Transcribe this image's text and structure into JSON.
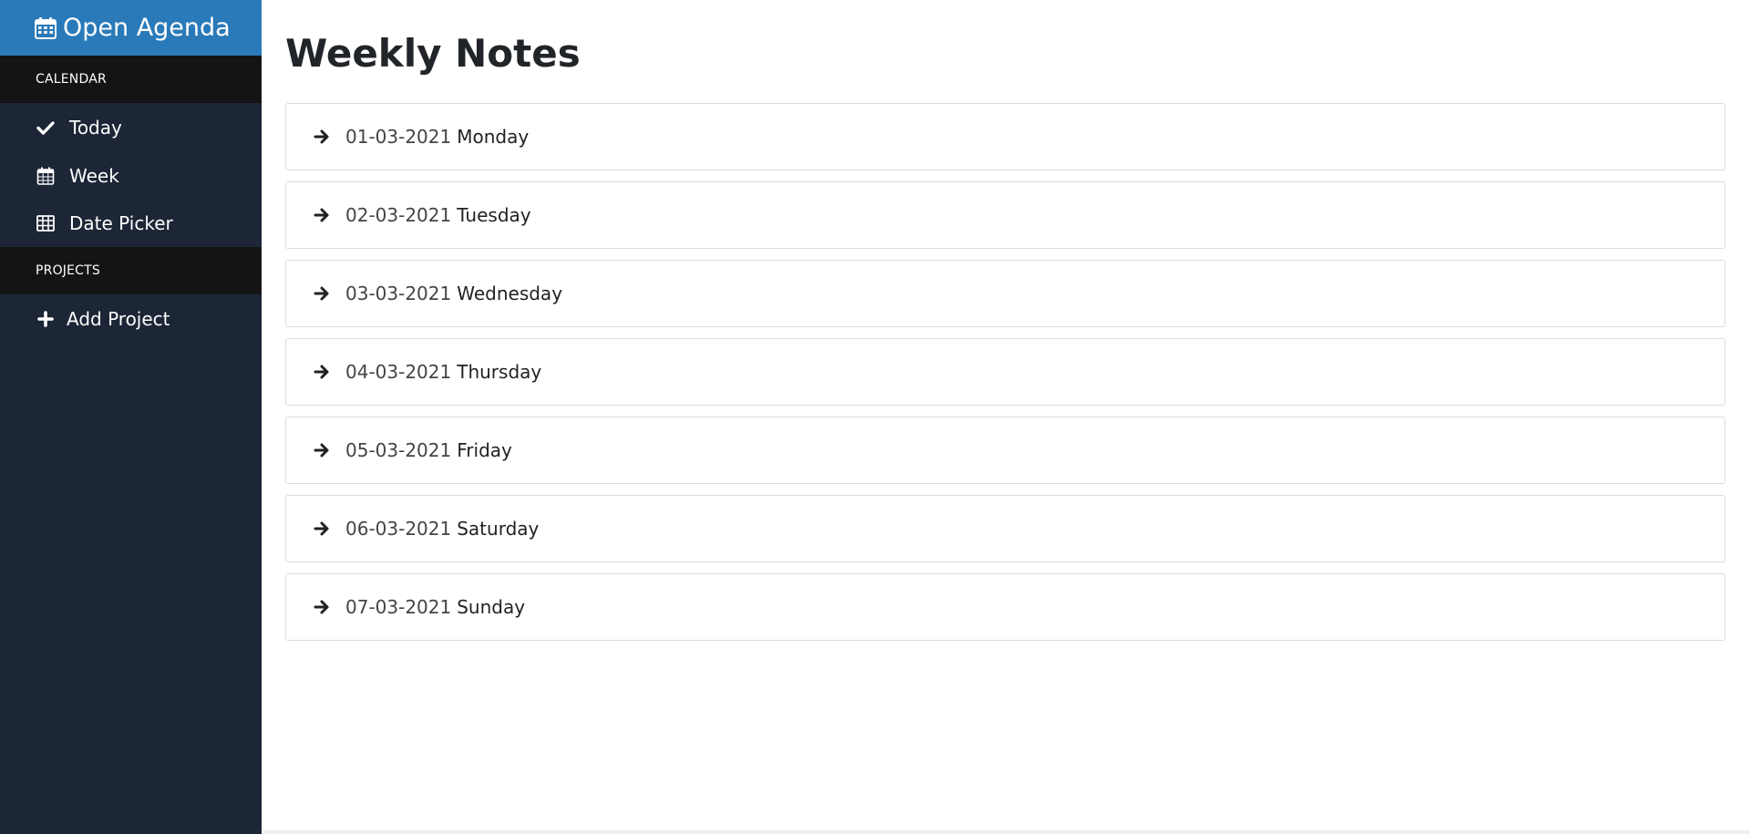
{
  "brand": {
    "title": "Open Agenda",
    "icon": "calendar-icon"
  },
  "sidebar": {
    "sections": [
      {
        "header": "CALENDAR",
        "items": [
          {
            "label": "Today",
            "icon": "check-icon"
          },
          {
            "label": "Week",
            "icon": "calendar-icon"
          },
          {
            "label": "Date Picker",
            "icon": "table-icon"
          }
        ]
      },
      {
        "header": "PROJECTS",
        "items": [
          {
            "label": "Add Project",
            "icon": "plus-icon"
          }
        ]
      }
    ]
  },
  "main": {
    "title": "Weekly Notes",
    "days": [
      {
        "date": "01-03-2021",
        "day": "Monday"
      },
      {
        "date": "02-03-2021",
        "day": "Tuesday"
      },
      {
        "date": "03-03-2021",
        "day": "Wednesday"
      },
      {
        "date": "04-03-2021",
        "day": "Thursday"
      },
      {
        "date": "05-03-2021",
        "day": "Friday"
      },
      {
        "date": "06-03-2021",
        "day": "Saturday"
      },
      {
        "date": "07-03-2021",
        "day": "Sunday"
      }
    ]
  },
  "colors": {
    "sidebar_bg": "#1c2636",
    "brand_bg": "#2a7ab9",
    "section_header_bg": "#141414"
  }
}
